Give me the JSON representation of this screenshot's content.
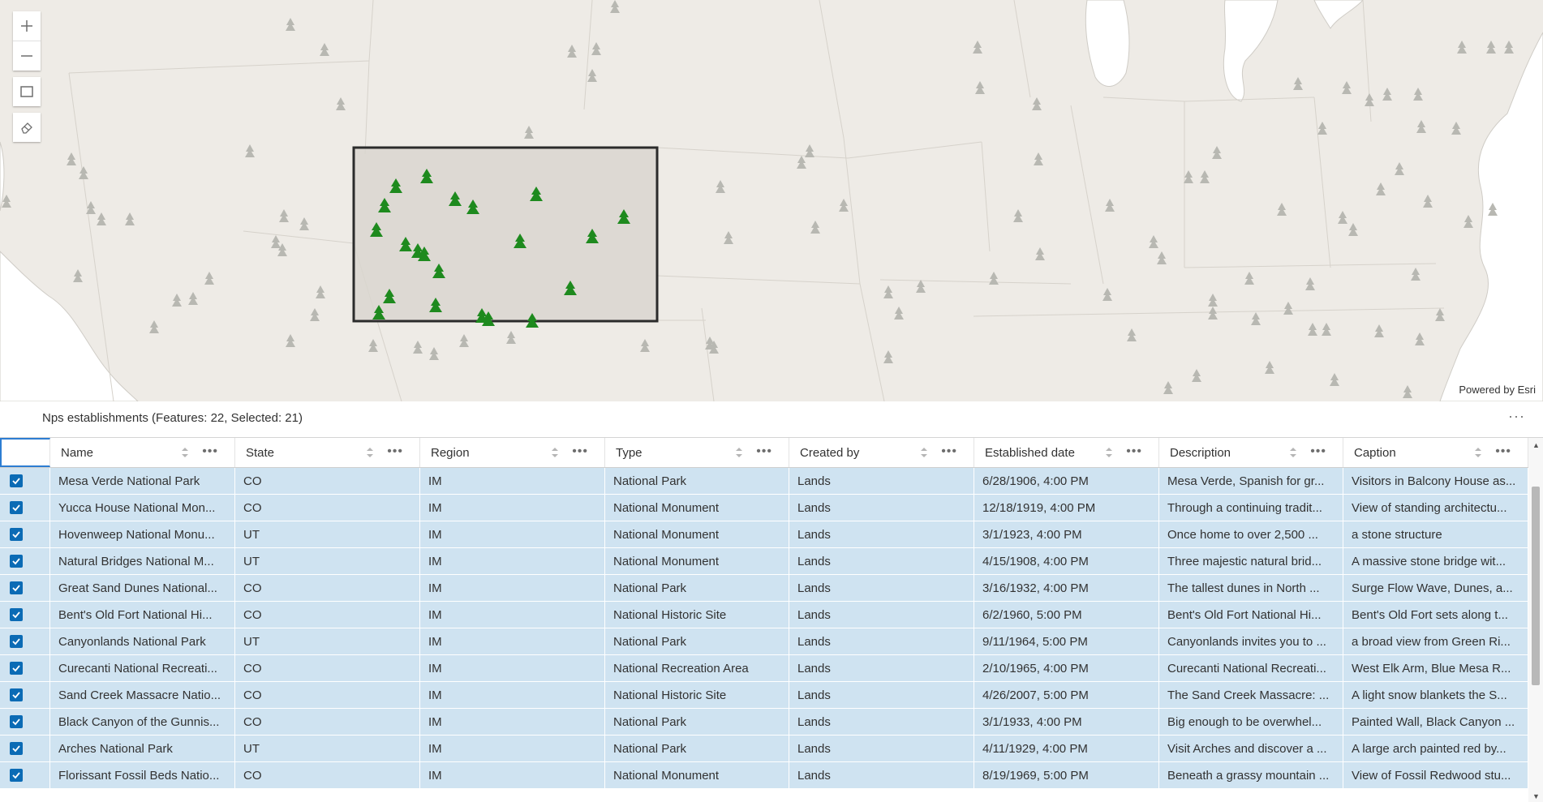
{
  "map": {
    "attribution": "Powered by Esri",
    "controls": {
      "zoom_in": "zoom-in",
      "zoom_out": "zoom-out",
      "select": "select-rectangle",
      "clear": "eraser"
    },
    "colors": {
      "basemap": "#eeebe6",
      "water": "#ffffff",
      "selection_fill": "#d9d6cf",
      "selection_border": "#2b2b2b",
      "selected_tree": "#1e8a1e",
      "unselected_tree": "#b8b8b2"
    }
  },
  "layer": {
    "title": "Nps establishments (Features: 22, Selected: 21)",
    "menu": "···"
  },
  "table": {
    "columns": [
      {
        "label": "Name"
      },
      {
        "label": "State"
      },
      {
        "label": "Region"
      },
      {
        "label": "Type"
      },
      {
        "label": "Created by"
      },
      {
        "label": "Established date"
      },
      {
        "label": "Description"
      },
      {
        "label": "Caption"
      }
    ],
    "rows": [
      {
        "name": "Mesa Verde National Park",
        "state": "CO",
        "region": "IM",
        "type": "National Park",
        "created_by": "Lands",
        "date": "6/28/1906, 4:00 PM",
        "description": "Mesa Verde, Spanish for gr...",
        "caption": "Visitors in Balcony House as..."
      },
      {
        "name": "Yucca House National Mon...",
        "state": "CO",
        "region": "IM",
        "type": "National Monument",
        "created_by": "Lands",
        "date": "12/18/1919, 4:00 PM",
        "description": "Through a continuing tradit...",
        "caption": "View of standing architectu..."
      },
      {
        "name": "Hovenweep National Monu...",
        "state": "UT",
        "region": "IM",
        "type": "National Monument",
        "created_by": "Lands",
        "date": "3/1/1923, 4:00 PM",
        "description": "Once home to over 2,500 ...",
        "caption": "a stone structure"
      },
      {
        "name": "Natural Bridges National M...",
        "state": "UT",
        "region": "IM",
        "type": "National Monument",
        "created_by": "Lands",
        "date": "4/15/1908, 4:00 PM",
        "description": "Three majestic natural brid...",
        "caption": "A massive stone bridge wit..."
      },
      {
        "name": "Great Sand Dunes National...",
        "state": "CO",
        "region": "IM",
        "type": "National Park",
        "created_by": "Lands",
        "date": "3/16/1932, 4:00 PM",
        "description": "The tallest dunes in North ...",
        "caption": "Surge Flow Wave, Dunes, a..."
      },
      {
        "name": "Bent's Old Fort National Hi...",
        "state": "CO",
        "region": "IM",
        "type": "National Historic Site",
        "created_by": "Lands",
        "date": "6/2/1960, 5:00 PM",
        "description": "Bent's Old Fort National Hi...",
        "caption": "Bent's Old Fort sets along t..."
      },
      {
        "name": "Canyonlands National Park",
        "state": "UT",
        "region": "IM",
        "type": "National Park",
        "created_by": "Lands",
        "date": "9/11/1964, 5:00 PM",
        "description": "Canyonlands invites you to ...",
        "caption": "a broad view from Green Ri..."
      },
      {
        "name": "Curecanti National Recreati...",
        "state": "CO",
        "region": "IM",
        "type": "National Recreation Area",
        "created_by": "Lands",
        "date": "2/10/1965, 4:00 PM",
        "description": "Curecanti National Recreati...",
        "caption": "West Elk Arm, Blue Mesa R..."
      },
      {
        "name": "Sand Creek Massacre Natio...",
        "state": "CO",
        "region": "IM",
        "type": "National Historic Site",
        "created_by": "Lands",
        "date": "4/26/2007, 5:00 PM",
        "description": "The Sand Creek Massacre: ...",
        "caption": "A light snow blankets the S..."
      },
      {
        "name": "Black Canyon of the Gunnis...",
        "state": "CO",
        "region": "IM",
        "type": "National Park",
        "created_by": "Lands",
        "date": "3/1/1933, 4:00 PM",
        "description": "Big enough to be overwhel...",
        "caption": "Painted Wall, Black Canyon ..."
      },
      {
        "name": "Arches National Park",
        "state": "UT",
        "region": "IM",
        "type": "National Park",
        "created_by": "Lands",
        "date": "4/11/1929, 4:00 PM",
        "description": "Visit Arches and discover a ...",
        "caption": "A large arch painted red by..."
      },
      {
        "name": "Florissant Fossil Beds Natio...",
        "state": "CO",
        "region": "IM",
        "type": "National Monument",
        "created_by": "Lands",
        "date": "8/19/1969, 5:00 PM",
        "description": "Beneath a grassy mountain ...",
        "caption": "View of Fossil Redwood stu..."
      }
    ]
  }
}
